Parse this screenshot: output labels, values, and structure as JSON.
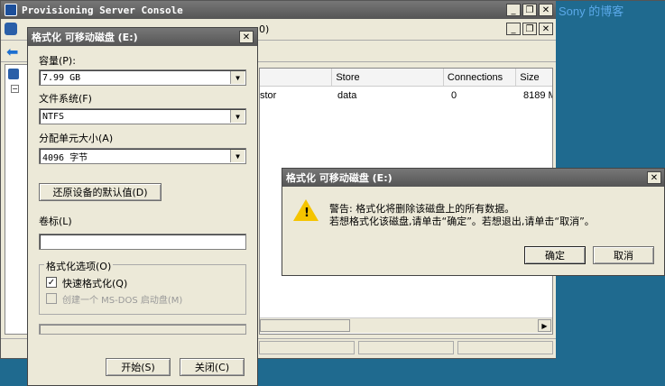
{
  "main_window": {
    "title": "Provisioning Server Console",
    "watermark": "Sony 的博客",
    "address_fragment": "0)",
    "table": {
      "columns": [
        "Store",
        "Connections",
        "Size"
      ],
      "rows": [
        {
          "name_fragment": "stor",
          "store": "data",
          "connections": "0",
          "size": "8189 M"
        }
      ]
    }
  },
  "format_dialog": {
    "title": "格式化 可移动磁盘 (E:)",
    "capacity_label": "容量(P):",
    "capacity_value": "7.99 GB",
    "fs_label": "文件系统(F)",
    "fs_value": "NTFS",
    "alloc_label": "分配单元大小(A)",
    "alloc_value": "4096 字节",
    "restore_button": "还原设备的默认值(D)",
    "volume_label": "卷标(L)",
    "volume_value": "",
    "options_group": "格式化选项(O)",
    "quick_format": "快速格式化(Q)",
    "msdos_disk": "创建一个 MS-DOS 启动盘(M)",
    "start_button": "开始(S)",
    "close_button": "关闭(C)"
  },
  "warning_dialog": {
    "title": "格式化 可移动磁盘 (E:)",
    "line1": "警告: 格式化将删除该磁盘上的所有数据。",
    "line2": "若想格式化该磁盘,请单击“确定”。若想退出,请单击“取消”。",
    "ok_button": "确定",
    "cancel_button": "取消"
  }
}
